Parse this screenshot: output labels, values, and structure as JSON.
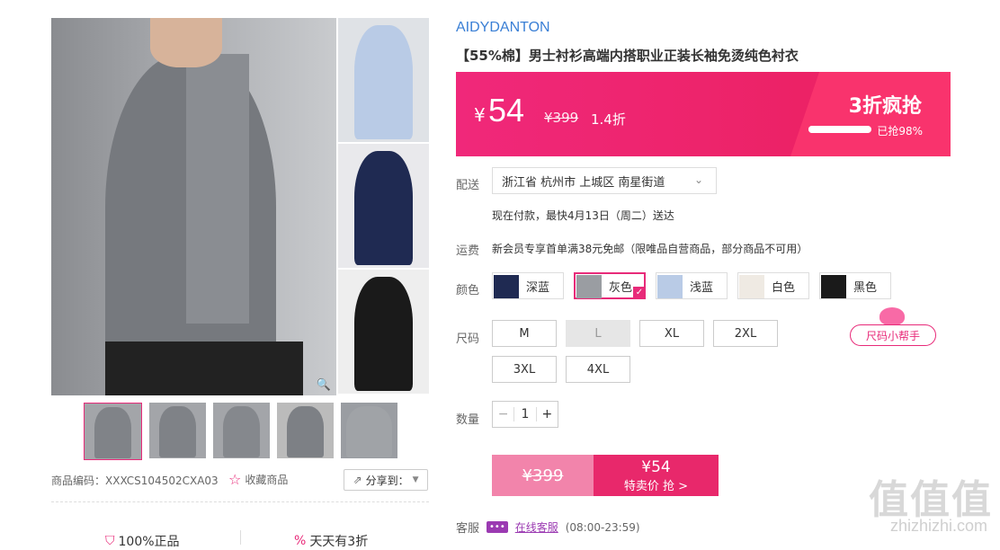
{
  "gallery": {
    "share_label": "分享到：",
    "product_code": "商品编码：XXXCS104502CXA03",
    "favorite_label": "收藏商品",
    "zoom_icon": "magnifier-icon",
    "bottom": [
      "100%正品",
      "天天有3折"
    ]
  },
  "product": {
    "brand": "AIDYDANTON",
    "title": "【55%棉】男士衬衫高端内搭职业正装长袖免烫纯色衬衣"
  },
  "price": {
    "currency": "¥",
    "current": "54",
    "original": "¥399",
    "discount": "1.4折",
    "deal_label": "3折疯抢",
    "sold_percent": 98,
    "sold_label": "已抢98%"
  },
  "delivery": {
    "label": "配送",
    "address": "浙江省 杭州市 上城区 南星街道",
    "eta": "现在付款，最快4月13日（周二）送达"
  },
  "shipping": {
    "label": "运费",
    "text": "新会员专享首单满38元免邮（限唯品自营商品，部分商品不可用）"
  },
  "colors": {
    "label": "颜色",
    "options": [
      {
        "name": "深蓝",
        "swatch": "#1f2a52"
      },
      {
        "name": "灰色",
        "swatch": "#9a9da2",
        "selected": true
      },
      {
        "name": "浅蓝",
        "swatch": "#b9cbe6"
      },
      {
        "name": "白色",
        "swatch": "#efeae3"
      },
      {
        "name": "黑色",
        "swatch": "#1a1a1a"
      }
    ]
  },
  "sizes": {
    "label": "尺码",
    "options": [
      "M",
      "L",
      "XL",
      "2XL",
      "3XL",
      "4XL"
    ],
    "disabled": "L",
    "helper": "尺码小帮手"
  },
  "quantity": {
    "label": "数量",
    "value": "1",
    "minus": "−",
    "plus": "+"
  },
  "buy": {
    "original": "¥399",
    "price": "¥54",
    "action": "特卖价 抢 >"
  },
  "service": {
    "label": "客服",
    "link": "在线客服",
    "hours": "(08:00-23:59)"
  },
  "watermark": {
    "text": "值值值",
    "url": "zhizhizhi.com"
  },
  "colors_theme": {
    "accent": "#e8286b",
    "brand_blue": "#3a7fd5"
  }
}
